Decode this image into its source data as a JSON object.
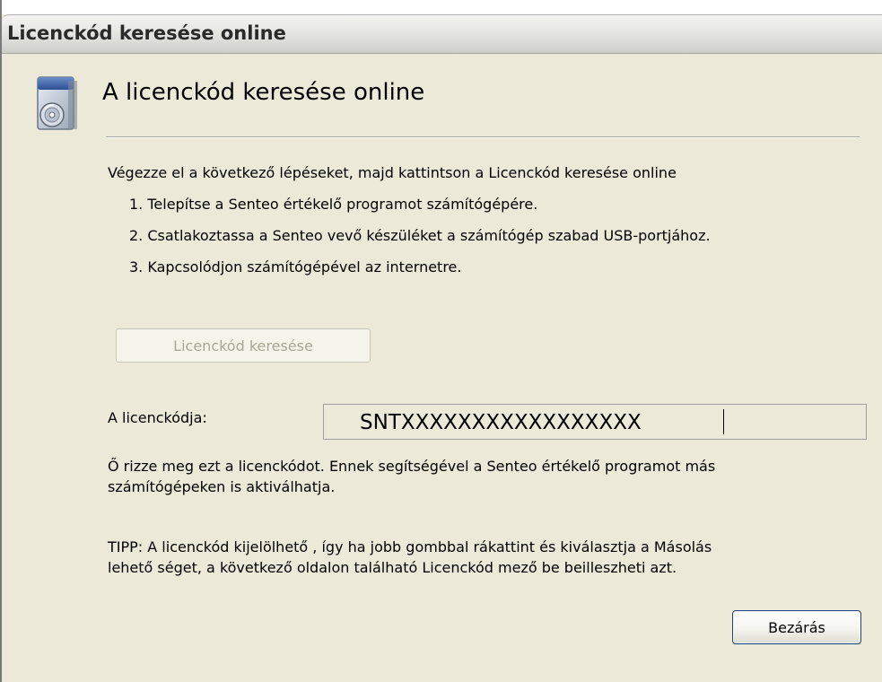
{
  "window": {
    "title": "Licenckód keresése online"
  },
  "header": {
    "title": "A licenckód keresése online",
    "icon": "cd-installer-icon"
  },
  "instructions": {
    "intro": "Végezze el a következő lépéseket, majd kattintson a Licenckód keresése online",
    "steps": [
      "1. Telepítse a Senteo értékelő programot számítógépére.",
      "2. Csatlakoztassa a Senteo vevő készüléket a számítógép szabad USB-portjához.",
      "3. Kapcsolódjon számítógépével az internetre."
    ]
  },
  "search_button": {
    "label": "Licenckód keresése",
    "enabled": false
  },
  "license": {
    "label": "A licenckódja:",
    "value": "SNTXXXXXXXXXXXXXXXXX"
  },
  "info": {
    "line1": "Ő rizze meg ezt a licenckódot. Ennek segítségével a Senteo értékelő programot más",
    "line2": "számítógépeken is aktiválhatja."
  },
  "tip": {
    "line1": "TIPP: A licenckód kijelölhető , így ha jobb gombbal rákattint és kiválasztja a Másolás",
    "line2": "lehető séget, a következő  oldalon található Licenckód mező be beilleszheti azt."
  },
  "close_button": {
    "label": "Bezárás"
  },
  "colors": {
    "dialog_background": "#ece9d8",
    "default_button_border": "#1f3f85",
    "disabled_text": "#a8a795"
  }
}
